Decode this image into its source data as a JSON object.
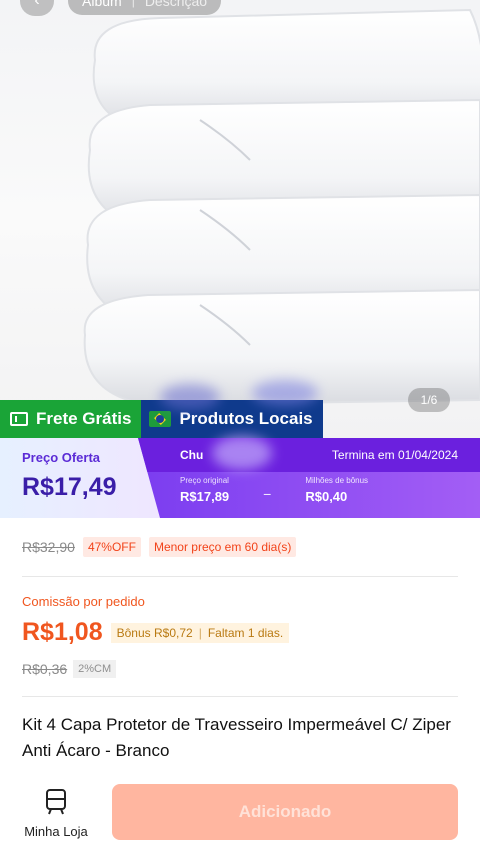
{
  "header": {
    "tabs": [
      "Álbum",
      "Descrição"
    ]
  },
  "gallery": {
    "counter": "1/6"
  },
  "badges": {
    "shipping": "Frete Grátis",
    "local": "Produtos Locais"
  },
  "offer": {
    "label": "Preço Oferta",
    "price": "R$17,49",
    "promo_name": "Chu",
    "ends": "Termina em 01/04/2024",
    "original_label": "Preço original",
    "original_value": "R$17,89",
    "bonus_label": "Milhões de bônus",
    "bonus_value": "R$0,40"
  },
  "pricing": {
    "list_price": "R$32,90",
    "discount": "47%OFF",
    "lowest": "Menor preço em 60 dia(s)"
  },
  "commission": {
    "label": "Comissão por pedido",
    "value": "R$1,08",
    "bonus": "Bônus R$0,72",
    "remaining": "Faltam 1 dias.",
    "old_value": "R$0,36",
    "rate": "2%CM"
  },
  "product": {
    "title": "Kit 4 Capa Protetor de Travesseiro Impermeável C/ Ziper Anti Ácaro - Branco"
  },
  "bottom_bar": {
    "store_label": "Minha Loja",
    "add_label": "Adicionado"
  },
  "colors": {
    "accent_orange": "#f0561f",
    "purple": "#6b20de",
    "green": "#1aa437",
    "navy": "#0f3a8c",
    "button": "#ffb6a0"
  }
}
